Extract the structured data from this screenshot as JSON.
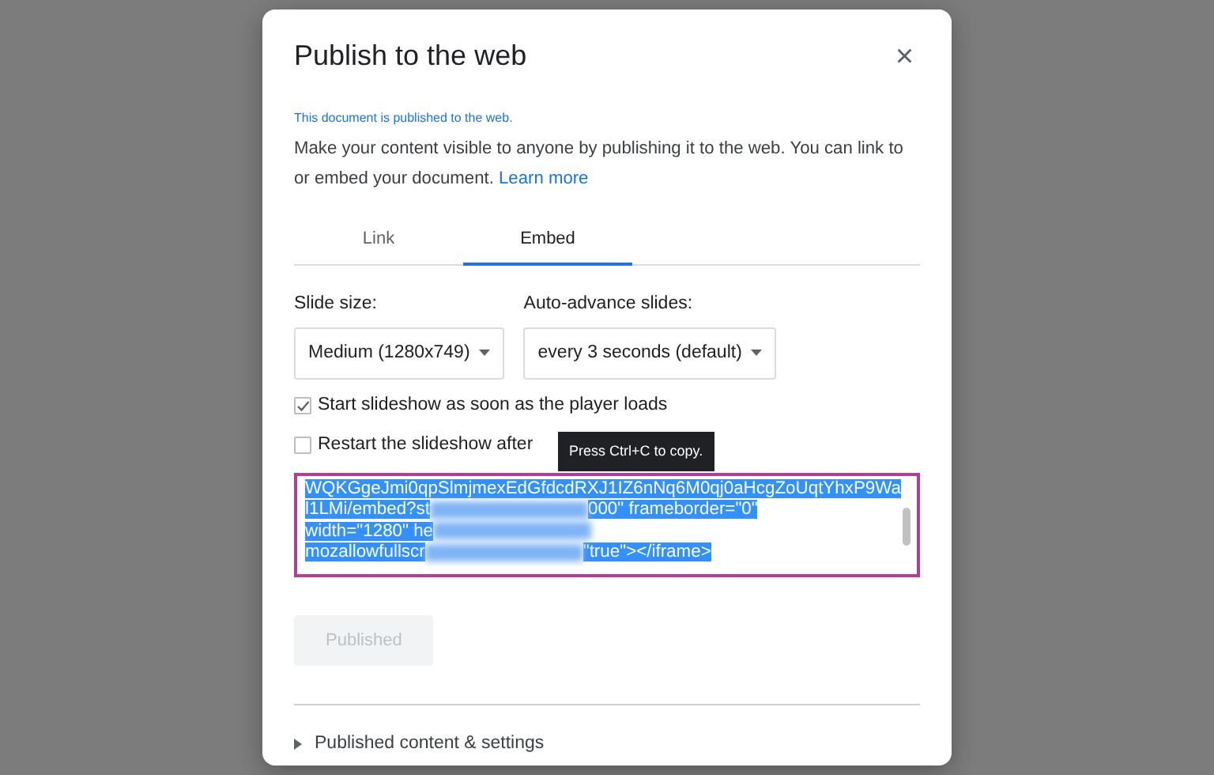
{
  "dialog": {
    "title": "Publish to the web",
    "close": "×",
    "status": "This document is published to the web.",
    "description": "Make your content visible to anyone by publishing it to the web. You can link to or embed your document.",
    "learn_more": "Learn more",
    "tabs": [
      {
        "label": "Link",
        "selected": false
      },
      {
        "label": "Embed",
        "selected": true
      }
    ],
    "selects": [
      {
        "label": "Slide size:",
        "value": "Medium (1280x749)"
      },
      {
        "label": "Auto-advance slides:",
        "value": "every 3 seconds (default)"
      }
    ],
    "checkboxes": [
      {
        "label": "Start slideshow as soon as the player loads",
        "checked": true
      },
      {
        "label": "Restart the slideshow after",
        "checked": false
      }
    ],
    "tooltip": "Press Ctrl+C to copy.",
    "embed_code": [
      [
        {
          "kind": "text",
          "text": "WQKGgeJmi0qpSlmjmexEdGfdcdRXJ1IZ6nNq6M0qj0aHcgZoUqtYhxP9Wa"
        }
      ],
      [
        {
          "kind": "text",
          "text": "l1LMi/embed?st"
        },
        {
          "kind": "redacted"
        },
        {
          "kind": "text",
          "text": "000\" frameborder=\"0\""
        }
      ],
      [
        {
          "kind": "text",
          "text": "width=\"1280\" he"
        },
        {
          "kind": "redacted"
        }
      ],
      [
        {
          "kind": "text",
          "text": "mozallowfullscr"
        },
        {
          "kind": "redacted"
        },
        {
          "kind": "text",
          "text": "\"true\"></iframe>"
        }
      ]
    ],
    "publish_button": {
      "label": "Published",
      "disabled": true
    },
    "expander": {
      "label": "Published content & settings",
      "expanded": false
    }
  }
}
